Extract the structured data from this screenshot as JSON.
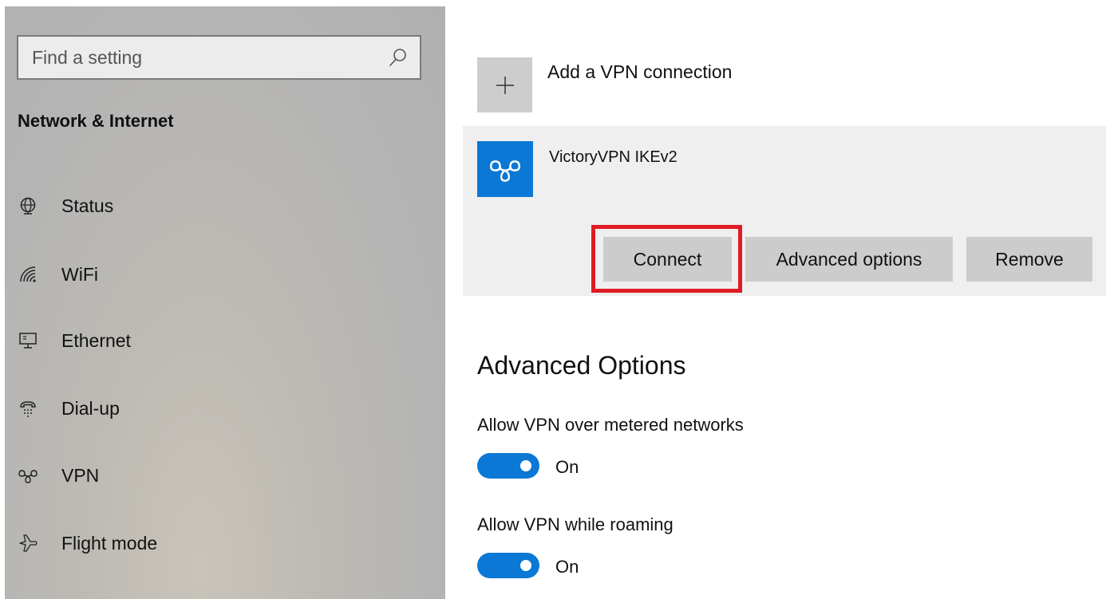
{
  "sidebar": {
    "search": {
      "placeholder": "Find a setting",
      "icon": "search-icon"
    },
    "section_title": "Network & Internet",
    "items": [
      {
        "label": "Status",
        "icon": "globe-icon"
      },
      {
        "label": "WiFi",
        "icon": "wifi-icon"
      },
      {
        "label": "Ethernet",
        "icon": "ethernet-icon"
      },
      {
        "label": "Dial-up",
        "icon": "dialup-icon"
      },
      {
        "label": "VPN",
        "icon": "vpn-icon"
      },
      {
        "label": "Flight mode",
        "icon": "airplane-icon"
      }
    ]
  },
  "main": {
    "add_vpn": {
      "label": "Add a VPN connection",
      "icon": "plus-icon"
    },
    "vpn_connection": {
      "name": "VictoryVPN IKEv2",
      "icon": "vpn-icon",
      "buttons": {
        "connect": "Connect",
        "advanced": "Advanced options",
        "remove": "Remove"
      },
      "highlight_color": "#e01b24"
    },
    "advanced": {
      "heading": "Advanced Options",
      "options": [
        {
          "label": "Allow VPN over metered networks",
          "state": "On",
          "enabled": true
        },
        {
          "label": "Allow VPN while roaming",
          "state": "On",
          "enabled": true
        }
      ]
    }
  },
  "colors": {
    "accent": "#0a78d4",
    "sidebar_bg": "#b4b4b4",
    "panel_bg": "#efefef",
    "button_bg": "#cccccc"
  }
}
